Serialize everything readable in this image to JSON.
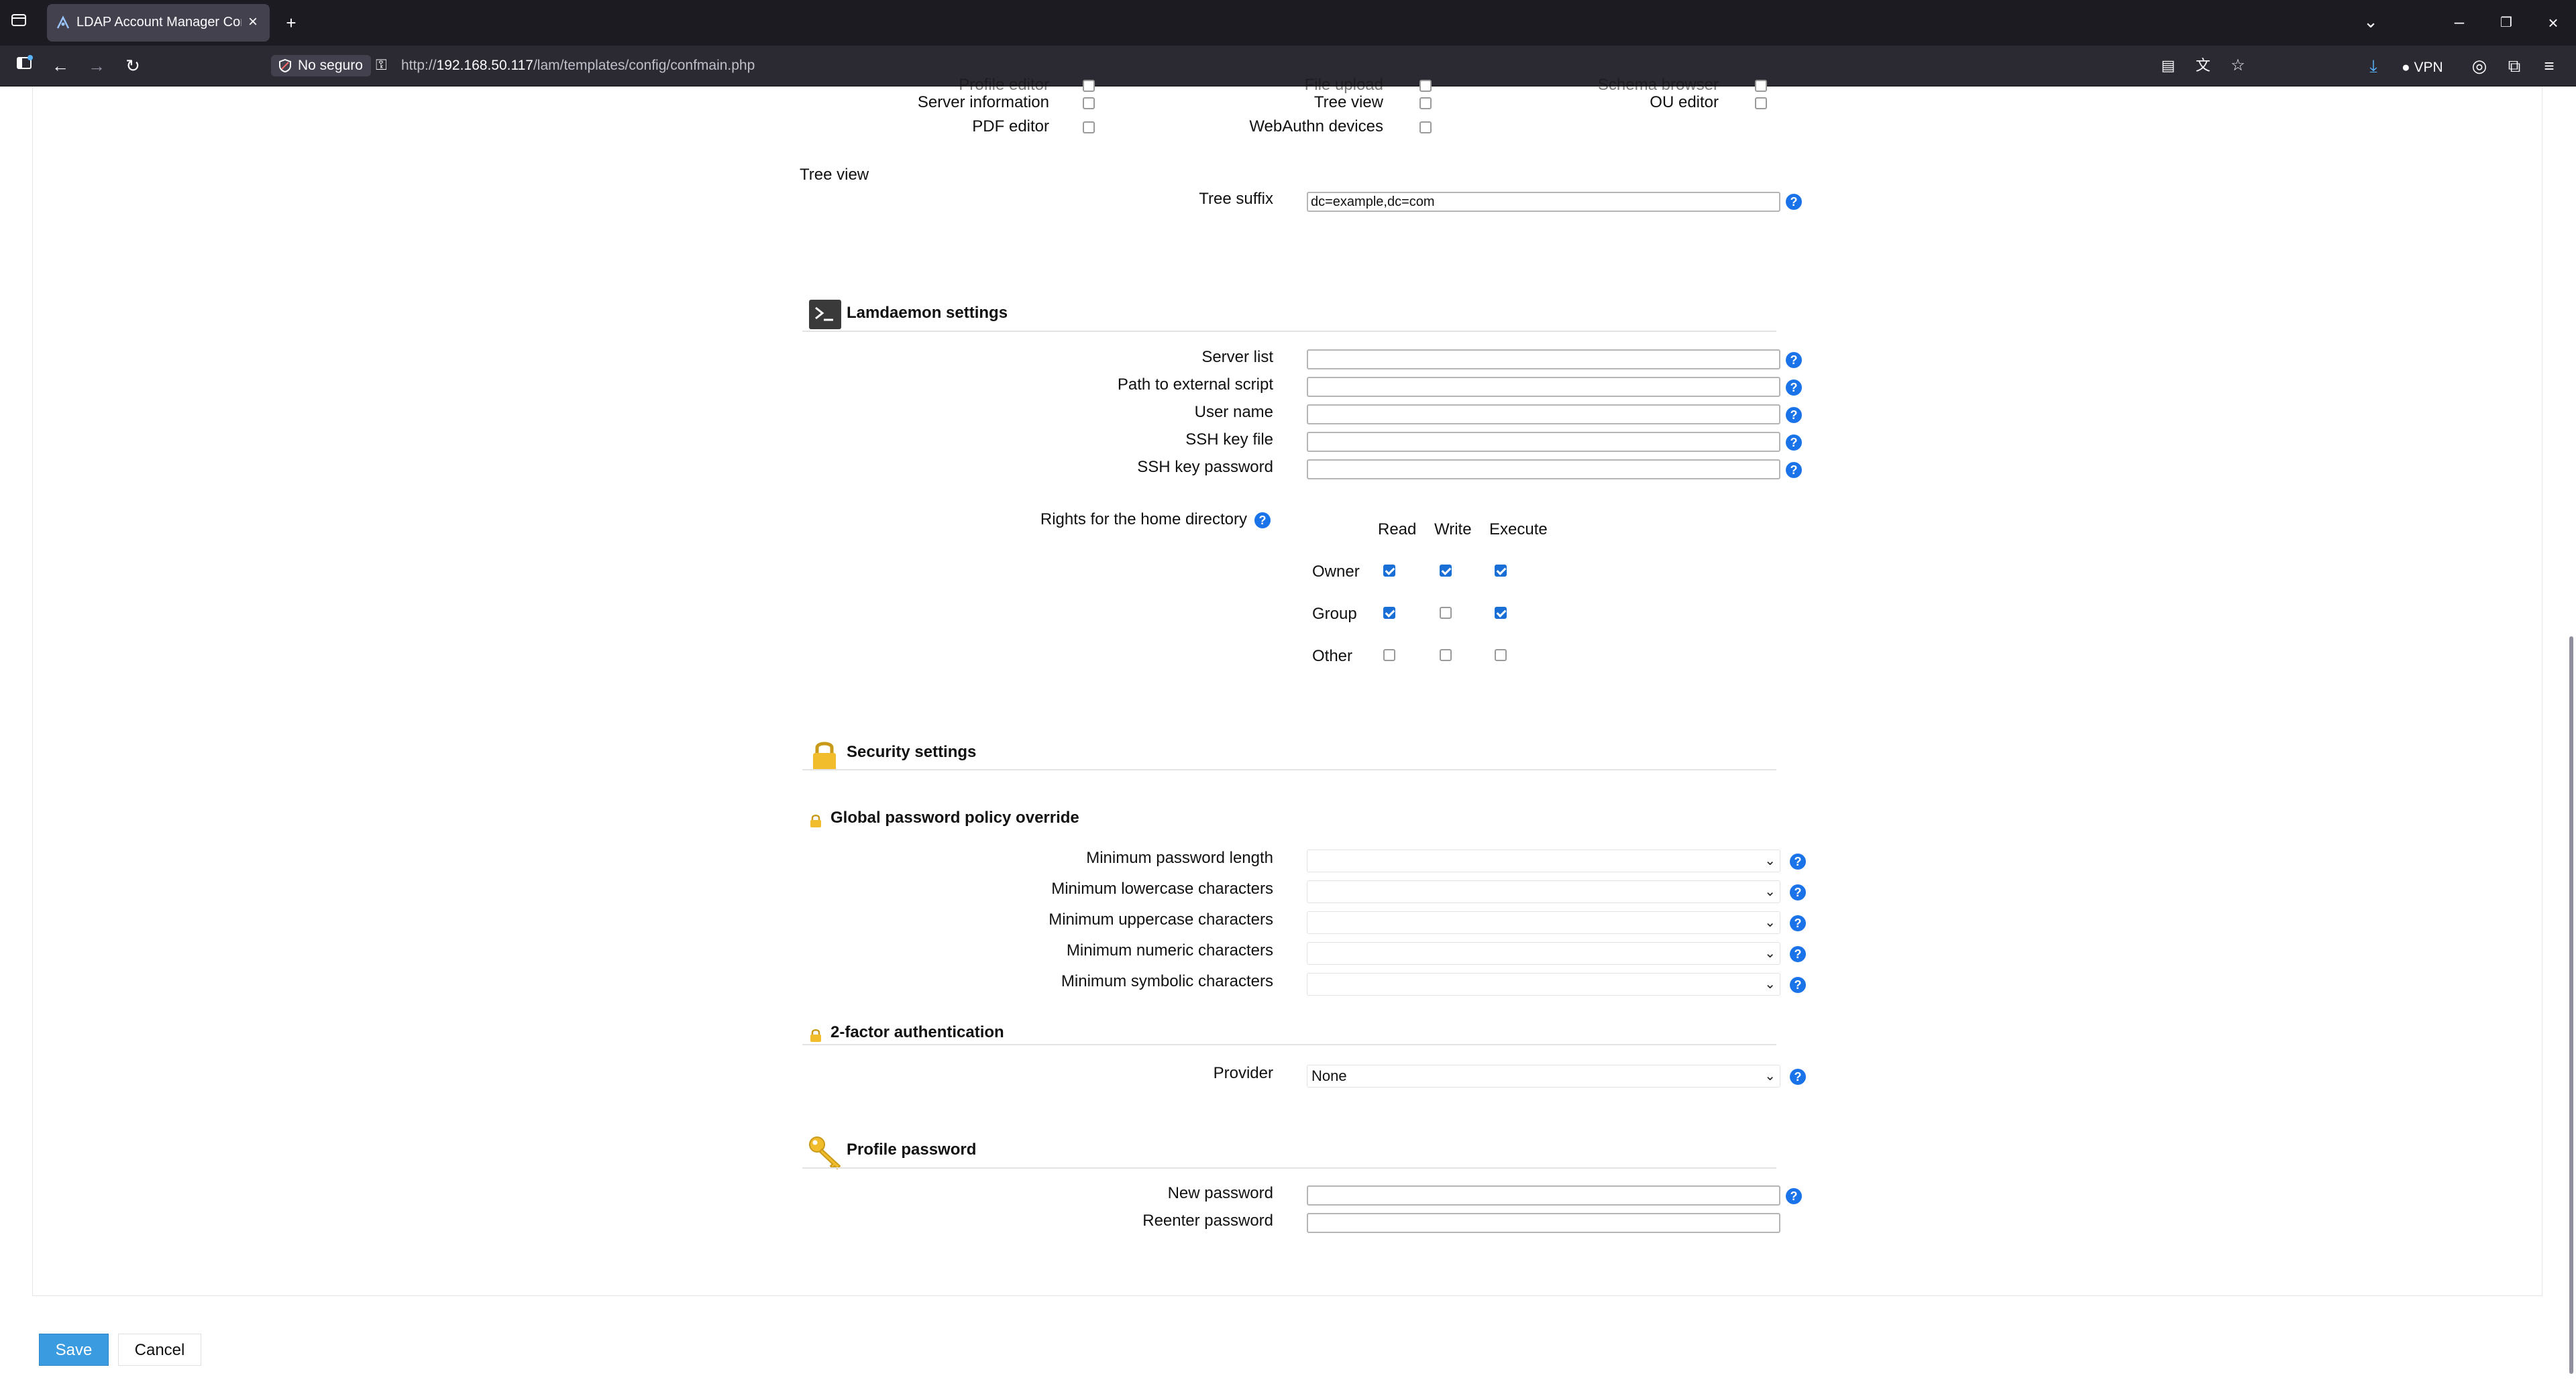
{
  "browser": {
    "tab_title": "LDAP Account Manager Config",
    "security_label": "No seguro",
    "url_prefix": "http://",
    "url_host": "192.168.50.117",
    "url_path": "/lam/templates/config/confmain.php",
    "vpn_label": "VPN"
  },
  "tools": {
    "partial_top": [
      "Profile editor",
      "File upload",
      "Schema browser"
    ],
    "row1": [
      {
        "label": "Server information",
        "checked": false
      },
      {
        "label": "Tree view",
        "checked": false
      },
      {
        "label": "OU editor",
        "checked": false
      }
    ],
    "row2": [
      {
        "label": "PDF editor",
        "checked": false
      },
      {
        "label": "WebAuthn devices",
        "checked": false
      }
    ]
  },
  "tree_view": {
    "heading": "Tree view",
    "suffix_label": "Tree suffix",
    "suffix_value": "dc=example,dc=com"
  },
  "lamdaemon": {
    "title": "Lamdaemon settings",
    "fields": [
      {
        "label": "Server list",
        "value": ""
      },
      {
        "label": "Path to external script",
        "value": ""
      },
      {
        "label": "User name",
        "value": ""
      },
      {
        "label": "SSH key file",
        "value": ""
      },
      {
        "label": "SSH key password",
        "value": ""
      }
    ],
    "rights_label": "Rights for the home directory",
    "rights_columns": [
      "Read",
      "Write",
      "Execute"
    ],
    "rights_rows": [
      {
        "name": "Owner",
        "values": [
          true,
          true,
          true
        ]
      },
      {
        "name": "Group",
        "values": [
          true,
          false,
          true
        ]
      },
      {
        "name": "Other",
        "values": [
          false,
          false,
          false
        ]
      }
    ]
  },
  "security": {
    "title": "Security settings",
    "policy_title": "Global password policy override",
    "policy_fields": [
      {
        "label": "Minimum password length",
        "value": ""
      },
      {
        "label": "Minimum lowercase characters",
        "value": ""
      },
      {
        "label": "Minimum uppercase characters",
        "value": ""
      },
      {
        "label": "Minimum numeric characters",
        "value": ""
      },
      {
        "label": "Minimum symbolic characters",
        "value": ""
      }
    ],
    "twofactor_title": "2-factor authentication",
    "provider_label": "Provider",
    "provider_value": "None"
  },
  "profile_password": {
    "title": "Profile password",
    "new_label": "New password",
    "reenter_label": "Reenter password"
  },
  "buttons": {
    "save": "Save",
    "cancel": "Cancel"
  },
  "help_glyph": "?"
}
